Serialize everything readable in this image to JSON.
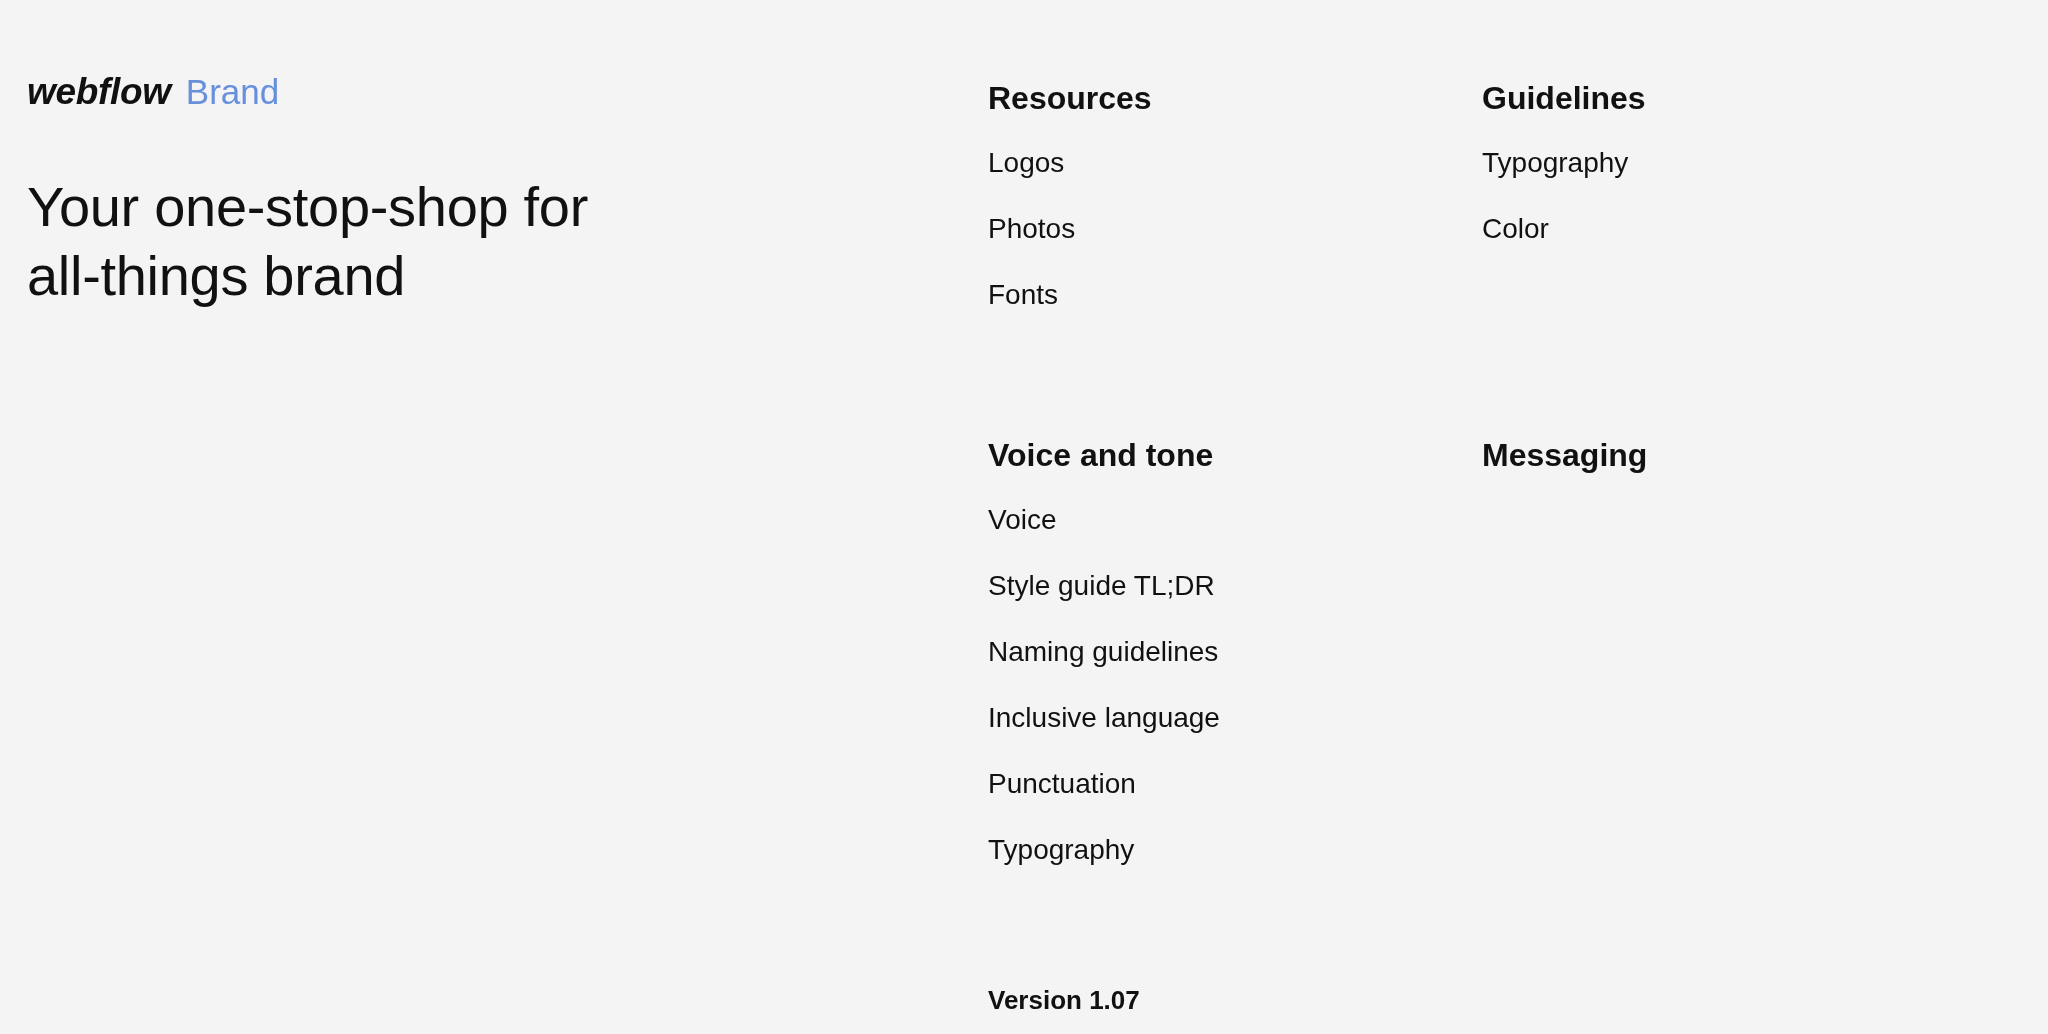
{
  "logo": {
    "wordmark": "webflow",
    "product": "Brand"
  },
  "headline": "Your one-stop-shop for all-things brand",
  "sections": [
    {
      "title": "Resources",
      "links": [
        "Logos",
        "Photos",
        "Fonts"
      ]
    },
    {
      "title": "Guidelines",
      "links": [
        "Typography",
        "Color"
      ]
    },
    {
      "title": "Voice and tone",
      "links": [
        "Voice",
        "Style guide TL;DR",
        "Naming guidelines",
        "Inclusive language",
        "Punctuation",
        "Typography"
      ]
    },
    {
      "title": "Messaging"
    }
  ],
  "version": "Version 1.07"
}
